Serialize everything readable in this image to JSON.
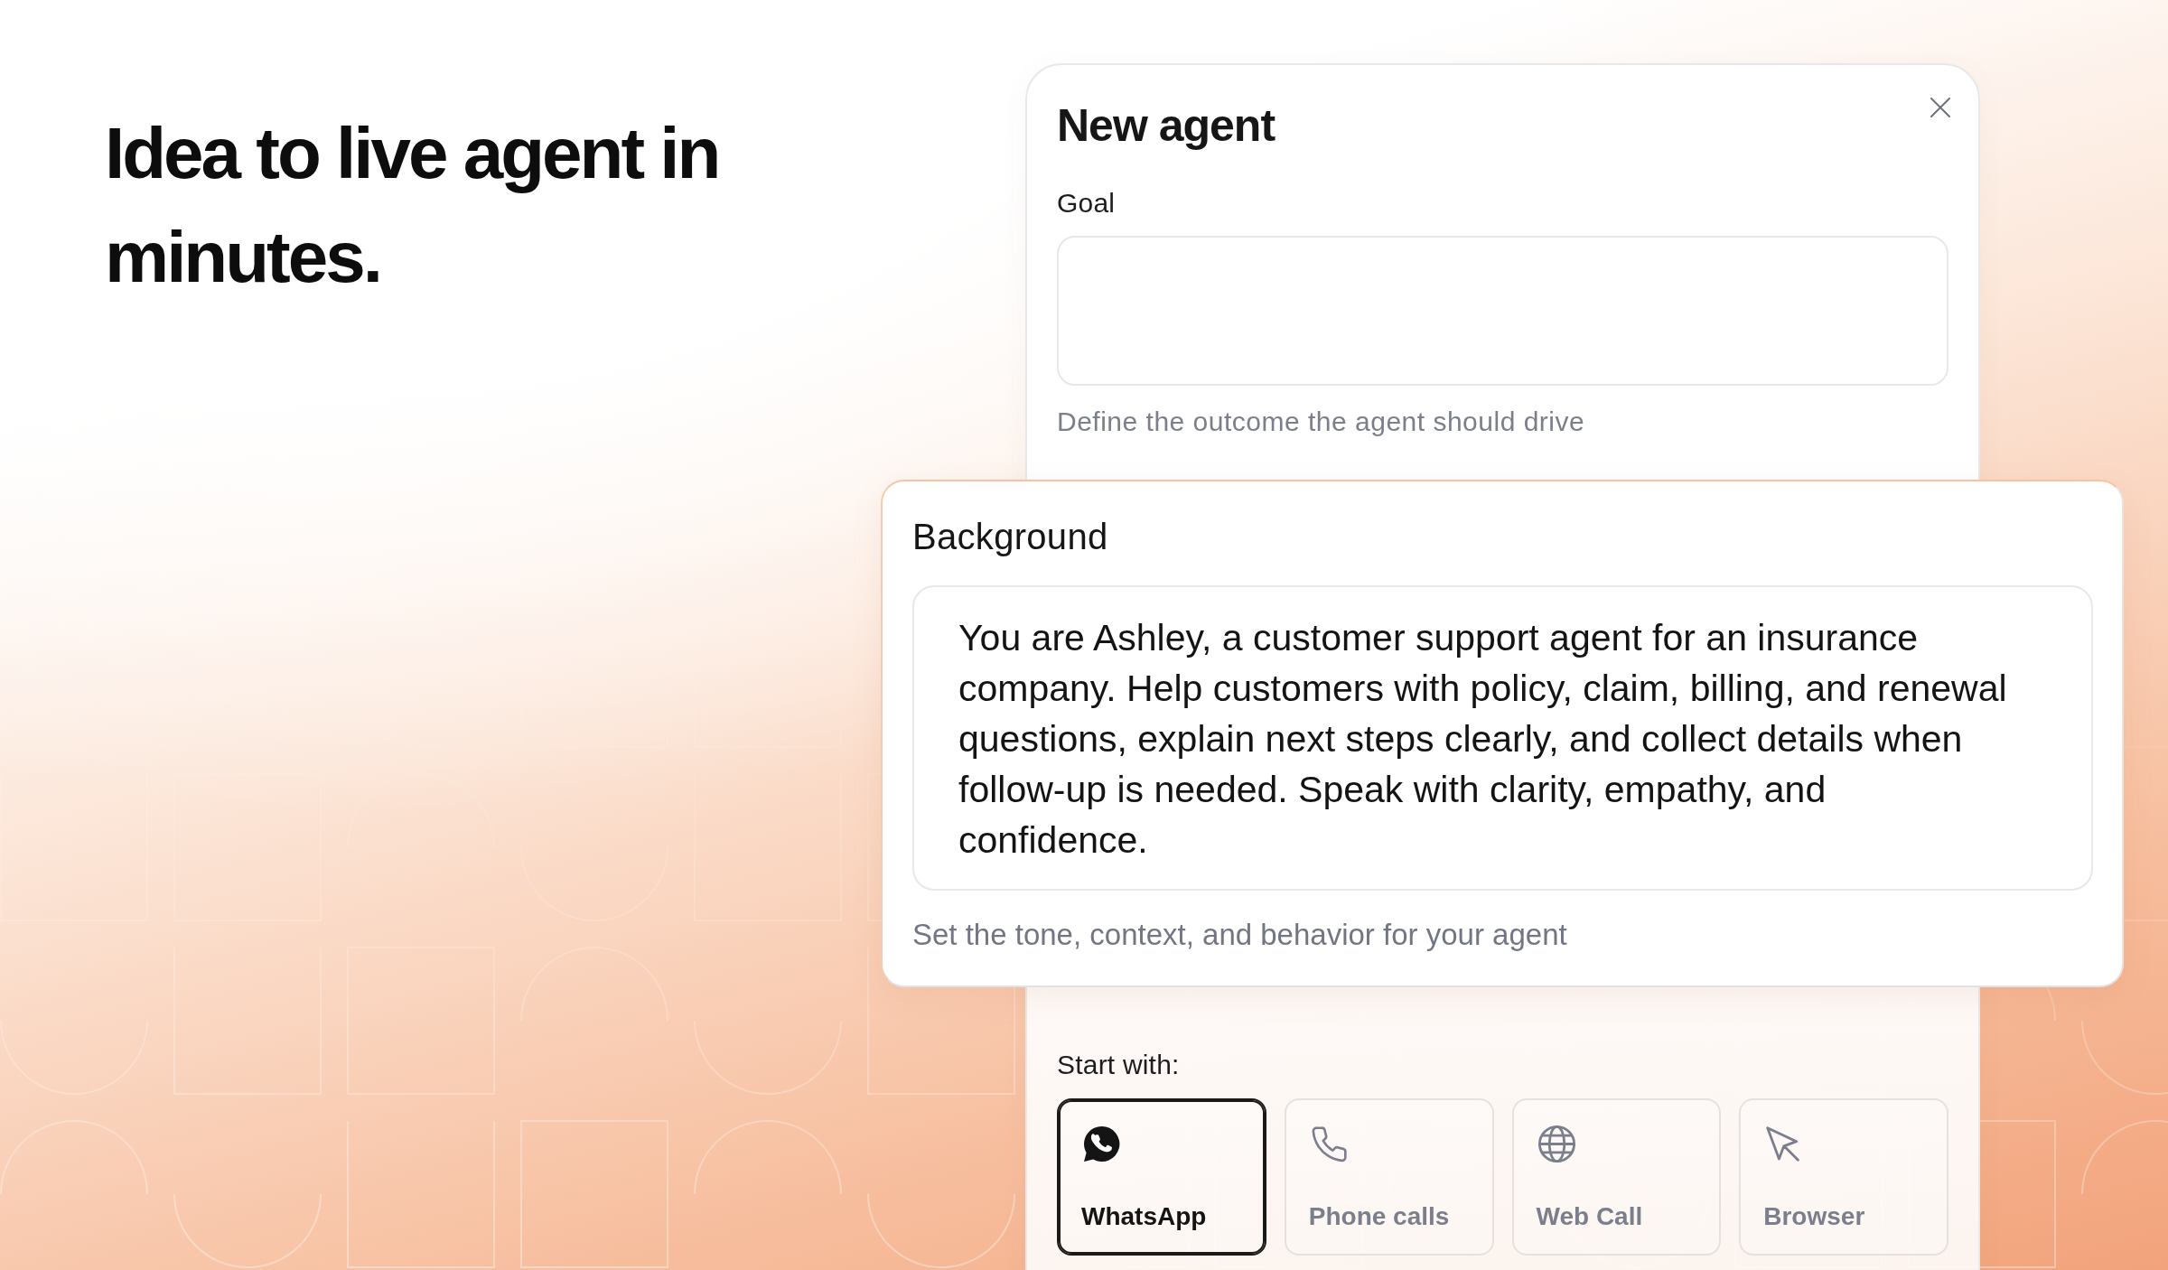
{
  "headline": "Idea to live agent in minutes.",
  "dialog": {
    "title": "New agent",
    "goal": {
      "label": "Goal",
      "hint": "Define the outcome the agent should drive"
    },
    "background": {
      "label": "Background",
      "value": "You are Ashley, a customer support agent for an insurance company. Help customers with policy, claim, billing, and renewal questions, explain next steps clearly, and collect details when follow-up is needed. Speak with clarity, empathy, and confidence.",
      "hint": "Set the tone, context, and behavior for your agent"
    },
    "start_with": {
      "label": "Start with:",
      "options": [
        {
          "label": "WhatsApp",
          "kind": "chat",
          "selected": true
        },
        {
          "label": "Phone calls",
          "kind": "phone",
          "selected": false
        },
        {
          "label": "Web Call",
          "kind": "globe",
          "selected": false
        },
        {
          "label": "Browser",
          "kind": "cursor",
          "selected": false
        }
      ]
    }
  }
}
